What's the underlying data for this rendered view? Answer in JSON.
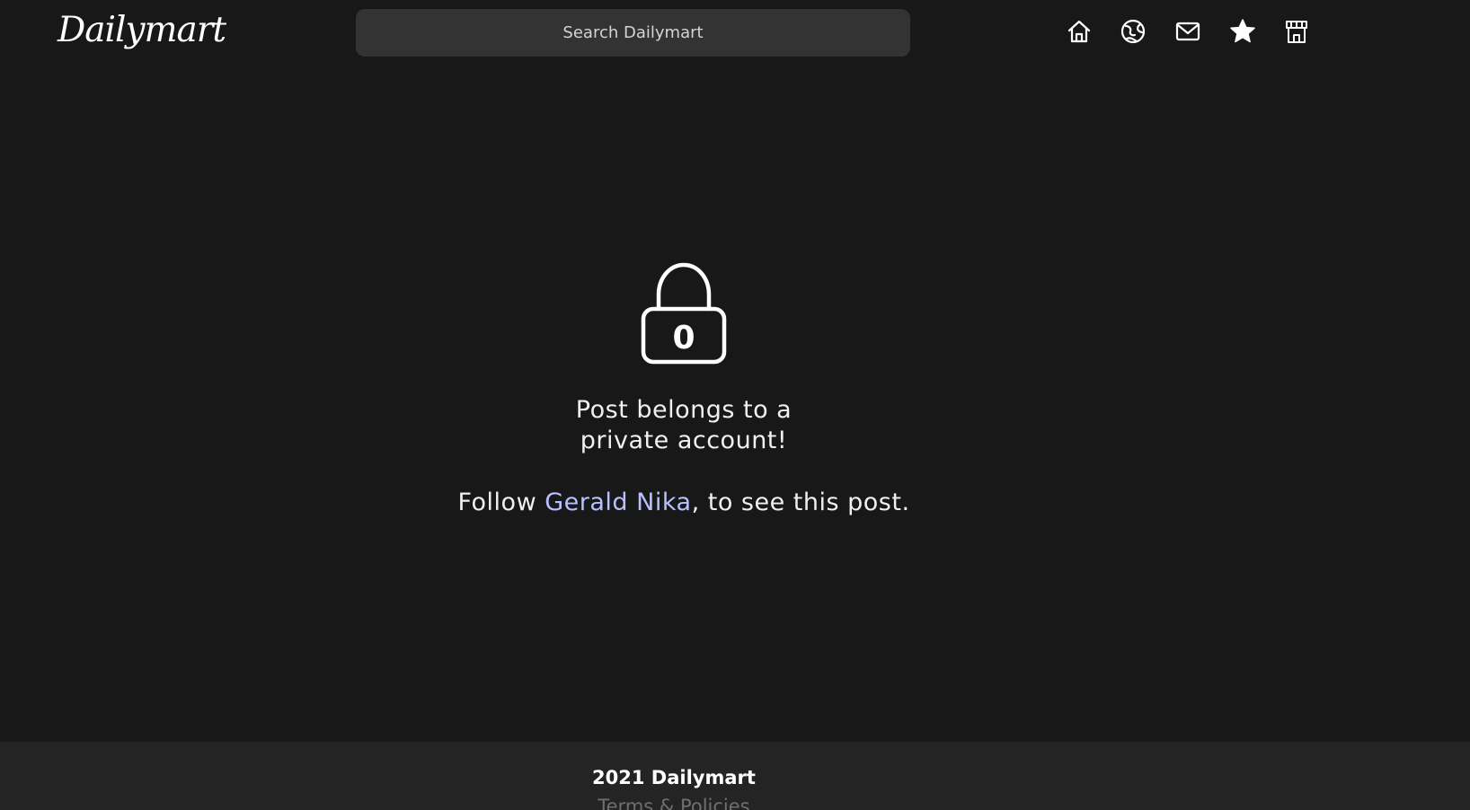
{
  "header": {
    "logo_text": "Dailymart",
    "search_placeholder": "Search Dailymart",
    "nav_icons": [
      "home-icon",
      "explore-icon",
      "messages-icon",
      "favorites-icon",
      "store-icon"
    ]
  },
  "main": {
    "lock_icon": "lock-icon",
    "lock_digit": "0",
    "message_line1": "Post belongs to a",
    "message_line2": "private account!",
    "follow_prefix": "Follow ",
    "follow_user": "Gerald Nika",
    "follow_suffix": ", to see this post."
  },
  "footer": {
    "copyright": "2021 Dailymart",
    "terms_link": "Terms & Policies"
  },
  "colors": {
    "background": "#181818",
    "footer_background": "#242424",
    "search_background": "#333333",
    "link": "#b8c0ff",
    "footer_link": "#6f6f6f",
    "text": "#f0f0f0"
  }
}
